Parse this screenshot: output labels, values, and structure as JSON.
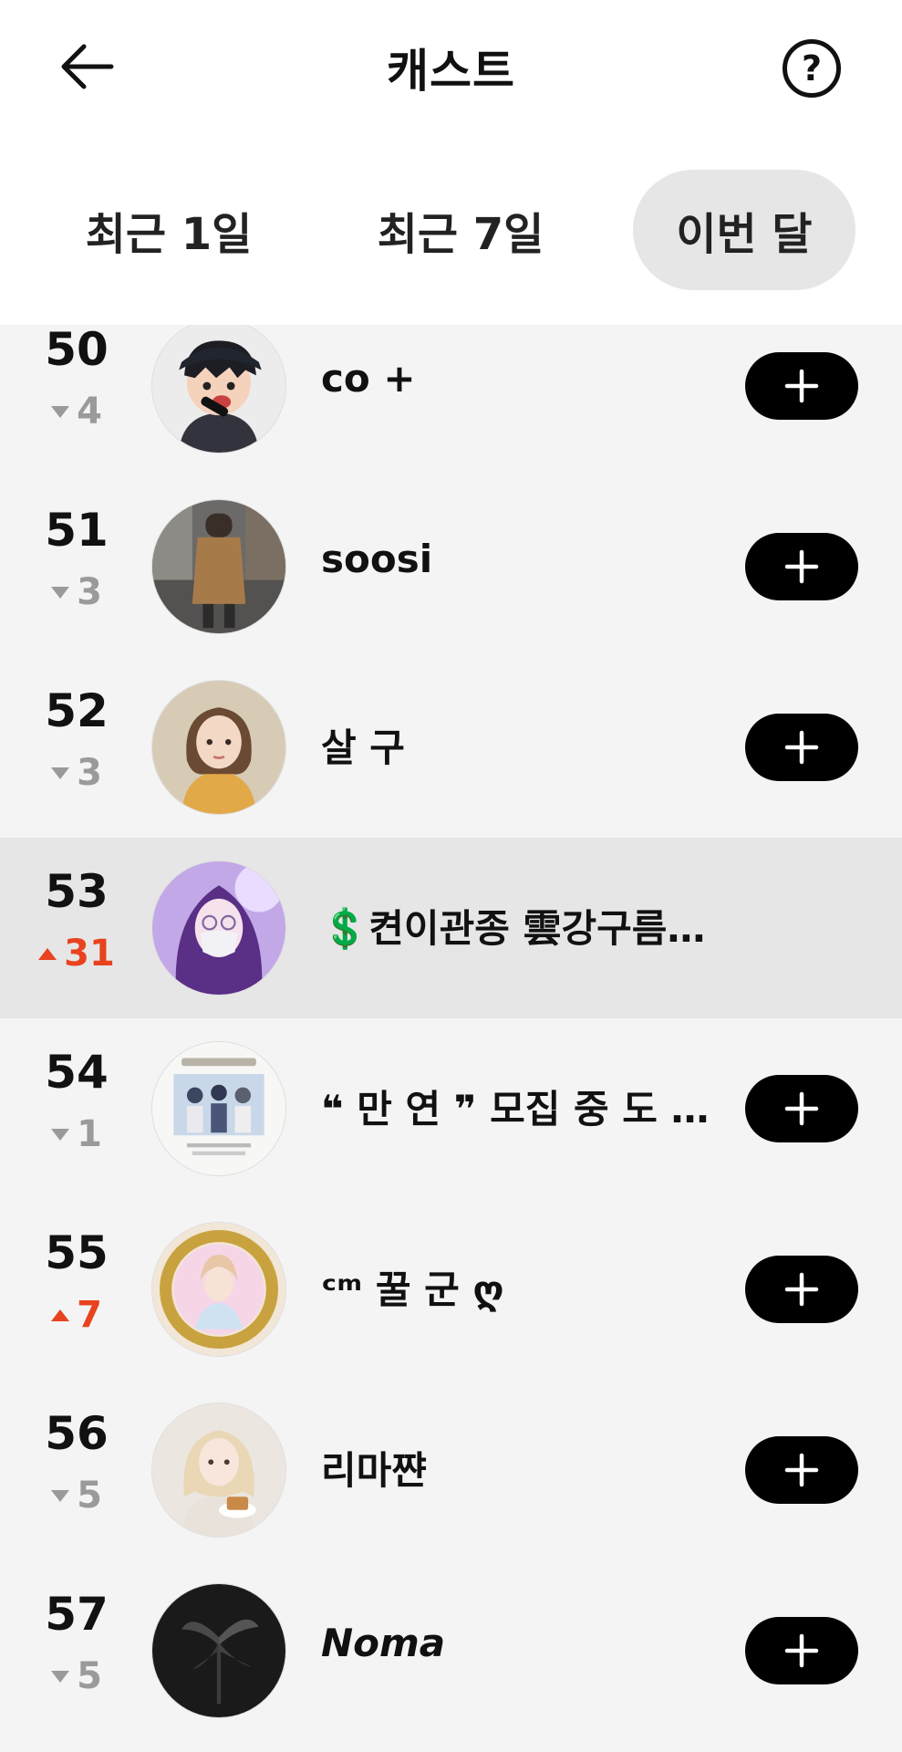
{
  "header": {
    "title": "캐스트",
    "help_label": "?"
  },
  "tabs": [
    {
      "label": "최근 1일",
      "selected": false
    },
    {
      "label": "최근 7일",
      "selected": false
    },
    {
      "label": "이번 달",
      "selected": true
    }
  ],
  "ranking": [
    {
      "rank": "50",
      "change": "4",
      "direction": "down",
      "name": "co +",
      "avatar_icon": "cartoon-boy-microphone-avatar",
      "follow": true
    },
    {
      "rank": "51",
      "change": "3",
      "direction": "down",
      "name": "soosi",
      "avatar_icon": "person-cafe-avatar",
      "follow": true
    },
    {
      "rank": "52",
      "change": "3",
      "direction": "down",
      "name": "살 구",
      "avatar_icon": "girl-yellow-sweater-avatar",
      "follow": true
    },
    {
      "rank": "53",
      "change": "31",
      "direction": "up",
      "name_prefix": "💲",
      "name": "켠이관종 雲강구름",
      "name_suffix": "💲",
      "avatar_icon": "purple-hair-girl-mask-avatar",
      "follow": false,
      "highlighted": true
    },
    {
      "rank": "54",
      "change": "1",
      "direction": "down",
      "name": "❝ 만 연 ❞ 모집 중 도 라...",
      "avatar_icon": "recruitment-poster-avatar",
      "follow": true
    },
    {
      "rank": "55",
      "change": "7",
      "direction": "up",
      "name": "ᶜᵐ 꿀 군 ღ",
      "avatar_icon": "golden-frame-boy-avatar",
      "follow": true
    },
    {
      "rank": "56",
      "change": "5",
      "direction": "down",
      "name": "리마쨘",
      "avatar_icon": "blonde-girl-cake-avatar",
      "follow": true
    },
    {
      "rank": "57",
      "change": "5",
      "direction": "down",
      "name": "Noma",
      "avatar_icon": "dark-lily-avatar",
      "follow": true,
      "italic": true
    }
  ],
  "colors": {
    "rank_up": "#e8431e",
    "rank_down": "#9a9a9a",
    "dollar": "#22b14c",
    "selected_tab_bg": "#e6e6e6",
    "list_bg": "#f4f4f4",
    "follow_button": "#000000"
  }
}
